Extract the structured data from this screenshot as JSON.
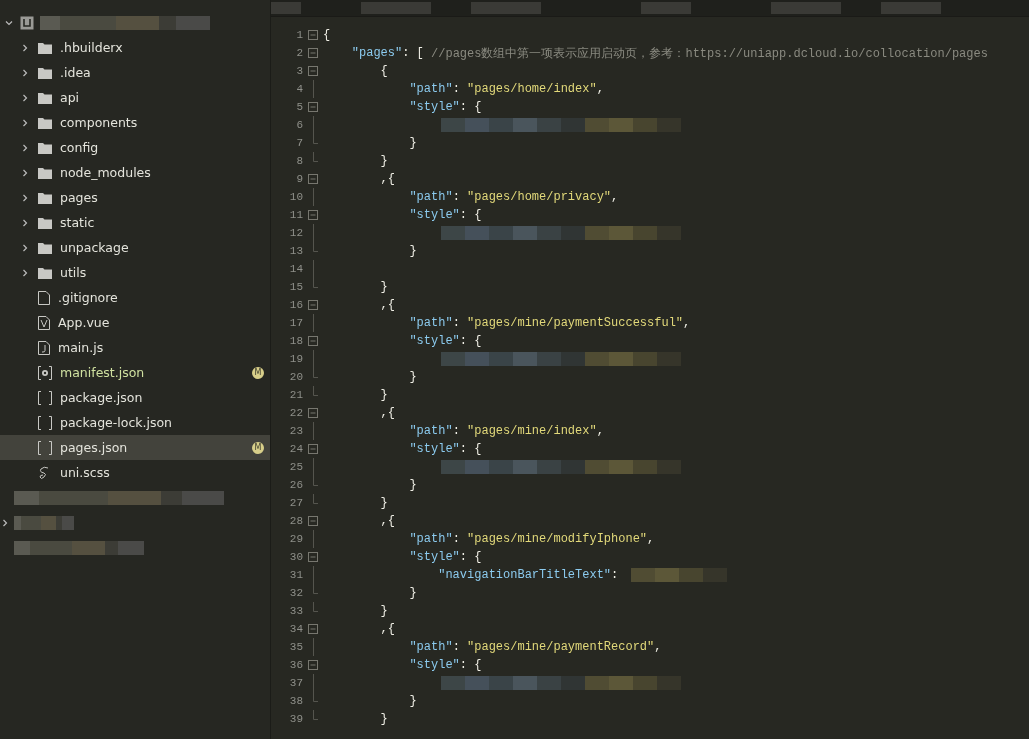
{
  "sidebar": {
    "root": {
      "expanded": true
    },
    "items": [
      {
        "kind": "folder",
        "name": ".hbuilderx",
        "expanded": false,
        "selected": false
      },
      {
        "kind": "folder",
        "name": ".idea",
        "expanded": false,
        "selected": false
      },
      {
        "kind": "folder",
        "name": "api",
        "expanded": false,
        "selected": false
      },
      {
        "kind": "folder",
        "name": "components",
        "expanded": false,
        "selected": false
      },
      {
        "kind": "folder",
        "name": "config",
        "expanded": false,
        "selected": false
      },
      {
        "kind": "folder",
        "name": "node_modules",
        "expanded": false,
        "selected": false
      },
      {
        "kind": "folder",
        "name": "pages",
        "expanded": false,
        "selected": false
      },
      {
        "kind": "folder",
        "name": "static",
        "expanded": false,
        "selected": false
      },
      {
        "kind": "folder",
        "name": "unpackage",
        "expanded": false,
        "selected": false
      },
      {
        "kind": "folder",
        "name": "utils",
        "expanded": false,
        "selected": false
      },
      {
        "kind": "file",
        "name": ".gitignore",
        "selected": false
      },
      {
        "kind": "vue",
        "name": "App.vue",
        "selected": false
      },
      {
        "kind": "js",
        "name": "main.js",
        "selected": false
      },
      {
        "kind": "settings",
        "name": "manifest.json",
        "selected": false,
        "badge": "M"
      },
      {
        "kind": "json",
        "name": "package.json",
        "selected": false
      },
      {
        "kind": "json",
        "name": "package-lock.json",
        "selected": false
      },
      {
        "kind": "json",
        "name": "pages.json",
        "selected": true,
        "badge": "M"
      },
      {
        "kind": "sass",
        "name": "uni.scss",
        "selected": false
      }
    ],
    "hidden_rows": [
      {
        "expandable": false
      },
      {
        "expandable": true
      },
      {
        "expandable": false
      }
    ]
  },
  "editor": {
    "lines": [
      {
        "number": "1",
        "kind": "fold",
        "tokens": [
          {
            "kind": "punct",
            "text": "{"
          }
        ]
      },
      {
        "number": "2",
        "kind": "fold",
        "tokens": [
          {
            "kind": "key",
            "text": "    \"pages\""
          },
          {
            "kind": "punct",
            "text": ": [ "
          },
          {
            "kind": "comment",
            "text": "//pages数组中第一项表示应用启动页，参考：https://uniapp.dcloud.io/collocation/pages"
          }
        ]
      },
      {
        "number": "3",
        "kind": "fold",
        "tokens": [
          {
            "kind": "punct",
            "text": "        {"
          }
        ]
      },
      {
        "number": "4",
        "kind": "guide",
        "tokens": [
          {
            "kind": "key",
            "text": "            \"path\""
          },
          {
            "kind": "punct",
            "text": ": "
          },
          {
            "kind": "string",
            "text": "\"pages/home/index\""
          },
          {
            "kind": "punct",
            "text": ","
          }
        ]
      },
      {
        "number": "5",
        "kind": "fold",
        "tokens": [
          {
            "kind": "key",
            "text": "            \"style\""
          },
          {
            "kind": "punct",
            "text": ": {"
          }
        ]
      },
      {
        "number": "6",
        "kind": "guide",
        "redacted": true
      },
      {
        "number": "7",
        "kind": "end",
        "tokens": [
          {
            "kind": "punct",
            "text": "            }"
          }
        ]
      },
      {
        "number": "8",
        "kind": "end",
        "tokens": [
          {
            "kind": "punct",
            "text": "        }"
          }
        ]
      },
      {
        "number": "9",
        "kind": "fold",
        "tokens": [
          {
            "kind": "punct",
            "text": "        ,{"
          }
        ]
      },
      {
        "number": "10",
        "kind": "guide",
        "tokens": [
          {
            "kind": "key",
            "text": "            \"path\""
          },
          {
            "kind": "punct",
            "text": ": "
          },
          {
            "kind": "string",
            "text": "\"pages/home/privacy\""
          },
          {
            "kind": "punct",
            "text": ","
          }
        ]
      },
      {
        "number": "11",
        "kind": "fold",
        "tokens": [
          {
            "kind": "key",
            "text": "            \"style\""
          },
          {
            "kind": "punct",
            "text": ": {"
          }
        ]
      },
      {
        "number": "12",
        "kind": "guide",
        "redacted": true
      },
      {
        "number": "13",
        "kind": "end",
        "tokens": [
          {
            "kind": "punct",
            "text": "            }"
          }
        ]
      },
      {
        "number": "14",
        "kind": "guide"
      },
      {
        "number": "15",
        "kind": "end",
        "tokens": [
          {
            "kind": "punct",
            "text": "        }"
          }
        ]
      },
      {
        "number": "16",
        "kind": "fold",
        "tokens": [
          {
            "kind": "punct",
            "text": "        ,{"
          }
        ]
      },
      {
        "number": "17",
        "kind": "guide",
        "tokens": [
          {
            "kind": "key",
            "text": "            \"path\""
          },
          {
            "kind": "punct",
            "text": ": "
          },
          {
            "kind": "string",
            "text": "\"pages/mine/paymentSuccessful\""
          },
          {
            "kind": "punct",
            "text": ","
          }
        ]
      },
      {
        "number": "18",
        "kind": "fold",
        "tokens": [
          {
            "kind": "key",
            "text": "            \"style\""
          },
          {
            "kind": "punct",
            "text": ": {"
          }
        ]
      },
      {
        "number": "19",
        "kind": "guide",
        "redacted": true
      },
      {
        "number": "20",
        "kind": "end",
        "tokens": [
          {
            "kind": "punct",
            "text": "            }"
          }
        ]
      },
      {
        "number": "21",
        "kind": "end",
        "tokens": [
          {
            "kind": "punct",
            "text": "        }"
          }
        ]
      },
      {
        "number": "22",
        "kind": "fold",
        "tokens": [
          {
            "kind": "punct",
            "text": "        ,{"
          }
        ]
      },
      {
        "number": "23",
        "kind": "guide",
        "tokens": [
          {
            "kind": "key",
            "text": "            \"path\""
          },
          {
            "kind": "punct",
            "text": ": "
          },
          {
            "kind": "string",
            "text": "\"pages/mine/index\""
          },
          {
            "kind": "punct",
            "text": ","
          }
        ]
      },
      {
        "number": "24",
        "kind": "fold",
        "tokens": [
          {
            "kind": "key",
            "text": "            \"style\""
          },
          {
            "kind": "punct",
            "text": ": {"
          }
        ]
      },
      {
        "number": "25",
        "kind": "guide",
        "redacted": true
      },
      {
        "number": "26",
        "kind": "end",
        "tokens": [
          {
            "kind": "punct",
            "text": "            }"
          }
        ]
      },
      {
        "number": "27",
        "kind": "end",
        "tokens": [
          {
            "kind": "punct",
            "text": "        }"
          }
        ]
      },
      {
        "number": "28",
        "kind": "fold",
        "tokens": [
          {
            "kind": "punct",
            "text": "        ,{"
          }
        ]
      },
      {
        "number": "29",
        "kind": "guide",
        "tokens": [
          {
            "kind": "key",
            "text": "            \"path\""
          },
          {
            "kind": "punct",
            "text": ": "
          },
          {
            "kind": "string",
            "text": "\"pages/mine/modifyIphone\""
          },
          {
            "kind": "punct",
            "text": ","
          }
        ]
      },
      {
        "number": "30",
        "kind": "fold",
        "tokens": [
          {
            "kind": "key",
            "text": "            \"style\""
          },
          {
            "kind": "punct",
            "text": ": {"
          }
        ]
      },
      {
        "number": "31",
        "kind": "guide",
        "redacted": true,
        "tokens": [
          {
            "kind": "key",
            "text": "                \"navigationBarTitleText\""
          },
          {
            "kind": "punct",
            "text": ": "
          }
        ]
      },
      {
        "number": "32",
        "kind": "end",
        "tokens": [
          {
            "kind": "punct",
            "text": "            }"
          }
        ]
      },
      {
        "number": "33",
        "kind": "end",
        "tokens": [
          {
            "kind": "punct",
            "text": "        }"
          }
        ]
      },
      {
        "number": "34",
        "kind": "fold",
        "tokens": [
          {
            "kind": "punct",
            "text": "        ,{"
          }
        ]
      },
      {
        "number": "35",
        "kind": "guide",
        "tokens": [
          {
            "kind": "key",
            "text": "            \"path\""
          },
          {
            "kind": "punct",
            "text": ": "
          },
          {
            "kind": "string",
            "text": "\"pages/mine/paymentRecord\""
          },
          {
            "kind": "punct",
            "text": ","
          }
        ]
      },
      {
        "number": "36",
        "kind": "fold",
        "tokens": [
          {
            "kind": "key",
            "text": "            \"style\""
          },
          {
            "kind": "punct",
            "text": ": {"
          }
        ]
      },
      {
        "number": "37",
        "kind": "guide",
        "redacted": true
      },
      {
        "number": "38",
        "kind": "end",
        "tokens": [
          {
            "kind": "punct",
            "text": "            }"
          }
        ]
      },
      {
        "number": "39",
        "kind": "end",
        "tokens": [
          {
            "kind": "punct",
            "text": "        }"
          }
        ]
      }
    ]
  }
}
